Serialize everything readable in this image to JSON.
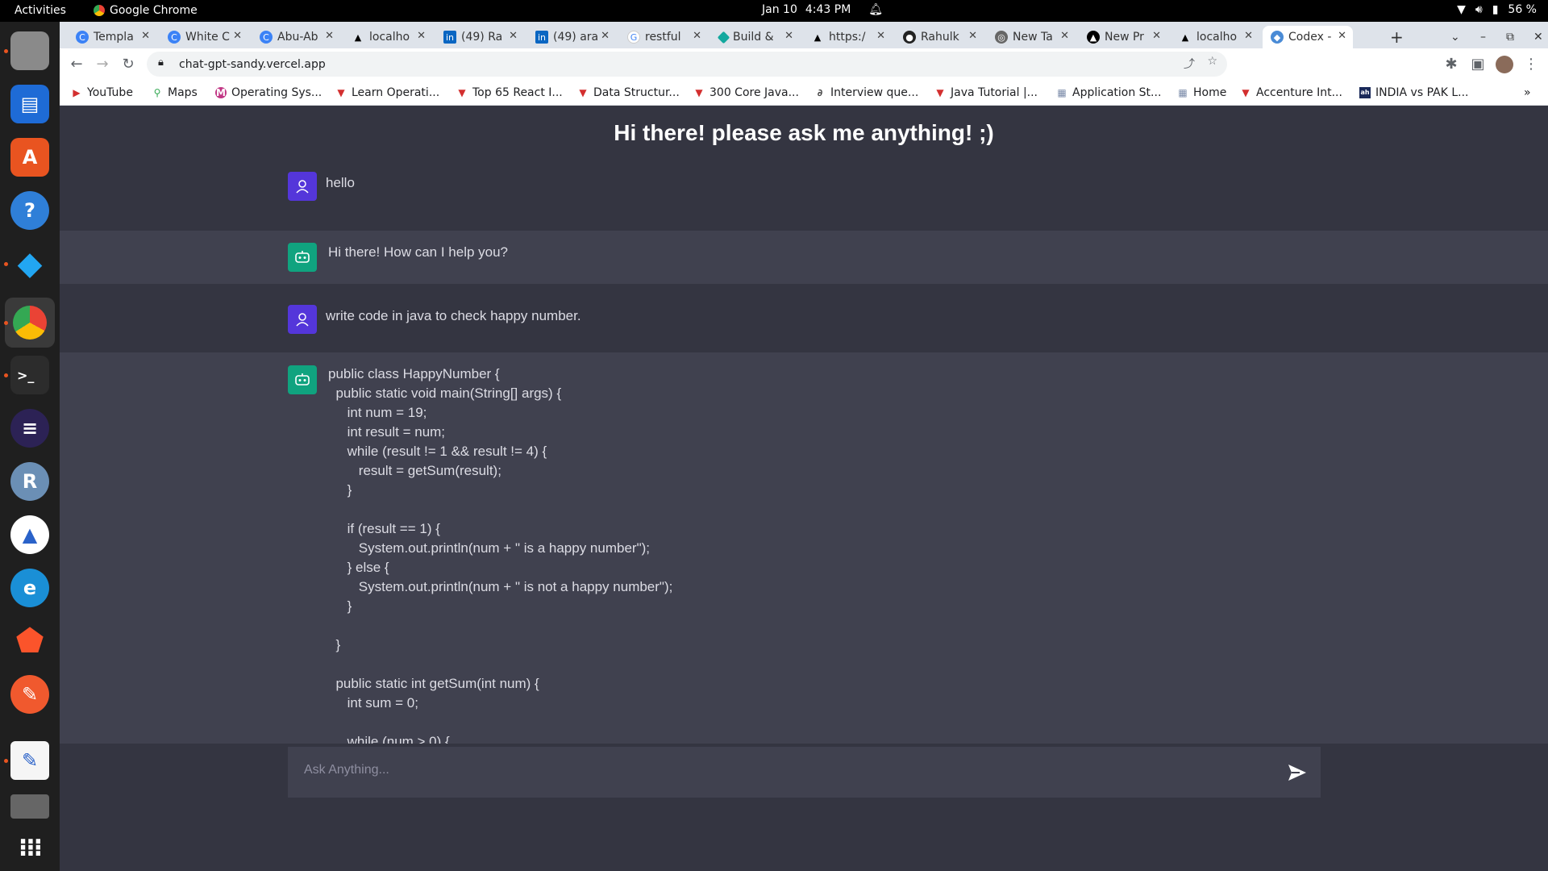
{
  "system_bar": {
    "activities": "Activities",
    "app_name": "Google Chrome",
    "date": "Jan 10",
    "time": "4:43 PM",
    "battery": "56 %"
  },
  "tabs": [
    {
      "label": "Templa"
    },
    {
      "label": "White C"
    },
    {
      "label": "Abu-Ab"
    },
    {
      "label": "localho"
    },
    {
      "label": "(49) Ra"
    },
    {
      "label": "(49) ara"
    },
    {
      "label": "restful"
    },
    {
      "label": "Build &"
    },
    {
      "label": "https:/"
    },
    {
      "label": "Rahulk"
    },
    {
      "label": "New Ta"
    },
    {
      "label": "New Pr"
    },
    {
      "label": "localho"
    },
    {
      "label": "Codex -"
    }
  ],
  "url": "chat-gpt-sandy.vercel.app",
  "bookmarks": [
    {
      "label": "YouTube"
    },
    {
      "label": "Maps"
    },
    {
      "label": "Operating Sys..."
    },
    {
      "label": "Learn Operati..."
    },
    {
      "label": "Top 65 React I..."
    },
    {
      "label": "Data Structur..."
    },
    {
      "label": "300 Core Java..."
    },
    {
      "label": "Interview que..."
    },
    {
      "label": "Java Tutorial |..."
    },
    {
      "label": "Application St..."
    },
    {
      "label": "Home"
    },
    {
      "label": "Accenture Int..."
    },
    {
      "label": "INDIA vs PAK L..."
    }
  ],
  "page": {
    "title": "Hi there! please ask me anything! ;)",
    "messages": [
      {
        "role": "user",
        "text": "hello"
      },
      {
        "role": "ai",
        "text": "Hi there! How can I help you?"
      },
      {
        "role": "user",
        "text": "write code in java to check happy number."
      },
      {
        "role": "ai",
        "text": "public class HappyNumber {\n  public static void main(String[] args) {\n     int num = 19;\n     int result = num;\n     while (result != 1 && result != 4) {\n        result = getSum(result);\n     }\n\n     if (result == 1) {\n        System.out.println(num + \" is a happy number\");\n     } else {\n        System.out.println(num + \" is not a happy number\");\n     }\n\n  }\n\n  public static int getSum(int num) {\n     int sum = 0;\n\n     while (num > 0) {"
      }
    ],
    "input_placeholder": "Ask Anything..."
  }
}
